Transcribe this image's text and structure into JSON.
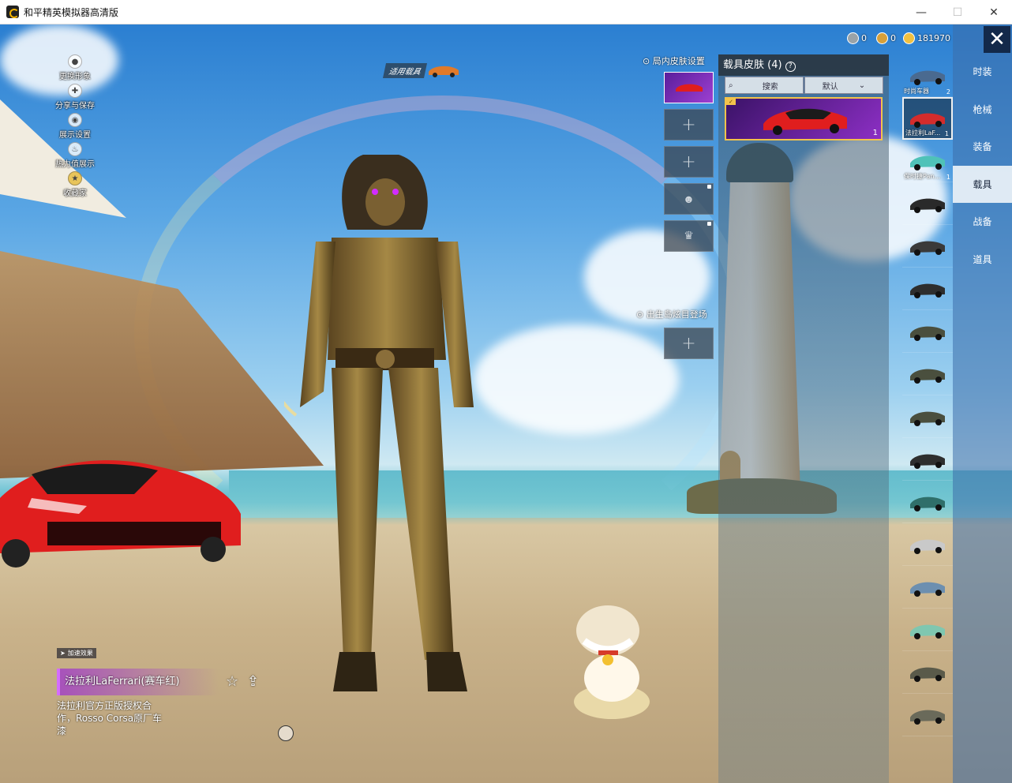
{
  "window": {
    "title": "和平精英模拟器高清版",
    "minimize": "—",
    "maximize": "☐",
    "close": "✕"
  },
  "left_menu": [
    {
      "label": "更换形象",
      "icon": "person-icon"
    },
    {
      "label": "分享与保存",
      "icon": "share-save-icon"
    },
    {
      "label": "展示设置",
      "icon": "eye-icon"
    },
    {
      "label": "热力值展示",
      "icon": "fire-icon"
    },
    {
      "label": "收藏家",
      "icon": "collector-badge-icon"
    }
  ],
  "apply_vehicle_label": "适用载具",
  "slots": {
    "title": "局内皮肤设置",
    "spawn_title": "出生岛炫目登场",
    "plus": "+"
  },
  "currency": [
    {
      "icon": "silver-coin-icon",
      "value": "0",
      "color": "#9aa3a8"
    },
    {
      "icon": "gold-badge-icon",
      "value": "0",
      "color": "#d6a03a"
    },
    {
      "icon": "coupon-icon",
      "value": "181970",
      "color": "#f0c040"
    }
  ],
  "skin_panel": {
    "title": "载具皮肤 (4)",
    "help": "?",
    "search_label": "搜索",
    "sort_label": "默认",
    "card_count": "1"
  },
  "vehicles": [
    {
      "name": "时尚车器",
      "count": "2",
      "color": "#4a6a90"
    },
    {
      "name": "法拉利LaF...",
      "count": "1",
      "color": "#d42c2c"
    },
    {
      "name": "保时捷Pan...",
      "count": "1",
      "color": "#4fc2b8"
    },
    {
      "name": "",
      "count": "",
      "color": "#2a2a2a"
    },
    {
      "name": "",
      "count": "",
      "color": "#3a3a3a"
    },
    {
      "name": "",
      "count": "",
      "color": "#2e2e2e"
    },
    {
      "name": "",
      "count": "",
      "color": "#4a4f3e"
    },
    {
      "name": "",
      "count": "",
      "color": "#4a4f3e"
    },
    {
      "name": "",
      "count": "",
      "color": "#4a4f3e"
    },
    {
      "name": "",
      "count": "",
      "color": "#2e2e2e"
    },
    {
      "name": "",
      "count": "",
      "color": "#2f6f6a"
    },
    {
      "name": "",
      "count": "",
      "color": "#c9c9c9"
    },
    {
      "name": "",
      "count": "",
      "color": "#6c8fb0"
    },
    {
      "name": "",
      "count": "",
      "color": "#7fc7b0"
    },
    {
      "name": "",
      "count": "",
      "color": "#5a5a4a"
    },
    {
      "name": "",
      "count": "",
      "color": "#6a6a5a"
    }
  ],
  "categories": [
    {
      "label": "时装",
      "active": false
    },
    {
      "label": "枪械",
      "active": false
    },
    {
      "label": "装备",
      "active": false
    },
    {
      "label": "载具",
      "active": true
    },
    {
      "label": "战备",
      "active": false
    },
    {
      "label": "道具",
      "active": false
    }
  ],
  "close_label": "✕",
  "vehicle_info": {
    "boost_label": "加速效果",
    "title": "法拉利LaFerrari(赛车红)",
    "description": "法拉利官方正版授权合作，Rosso Corsa原厂车漆"
  },
  "colors": {
    "accent_purple": "#9d3fd1",
    "selected_border": "#f3c34b",
    "nav_blue": "#3c6eaa"
  }
}
